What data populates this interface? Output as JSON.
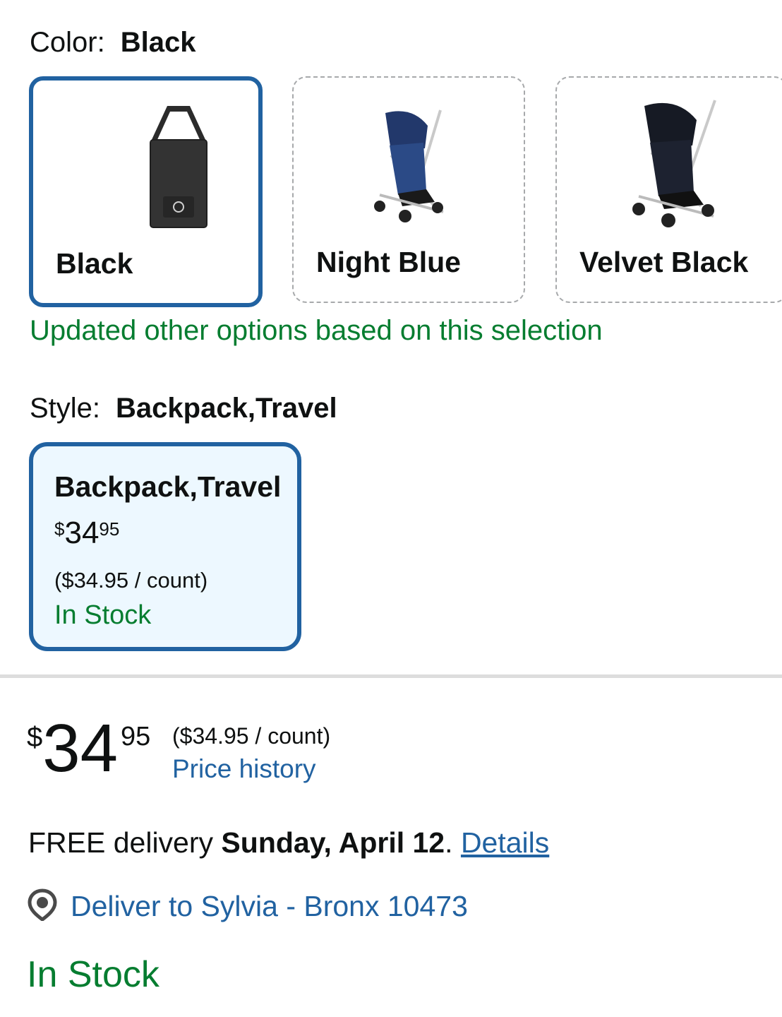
{
  "color": {
    "label": "Color:",
    "value": "Black",
    "options": [
      {
        "name": "Black",
        "thumb": "travel-bag-icon",
        "selected": true
      },
      {
        "name": "Night Blue",
        "thumb": "stroller-icon",
        "selected": false
      },
      {
        "name": "Velvet Black",
        "thumb": "stroller-icon",
        "selected": false
      }
    ],
    "update_note": "Updated other options based on this selection"
  },
  "style": {
    "label": "Style:",
    "value": "Backpack,Travel",
    "card": {
      "title": "Backpack,Travel",
      "price_symbol": "$",
      "price_whole": "34",
      "price_fraction": "95",
      "unit_price": "($34.95 / count)",
      "availability": "In Stock"
    }
  },
  "price": {
    "symbol": "$",
    "whole": "34",
    "fraction": "95",
    "unit_price": "($34.95 / count)",
    "history_link": "Price history"
  },
  "delivery": {
    "prefix": "FREE delivery",
    "date": "Sunday, April 12",
    "suffix": ".",
    "details_link": "Details"
  },
  "deliver_to": {
    "icon": "location-pin-icon",
    "text": "Deliver to Sylvia - Bronx 10473"
  },
  "availability": "In Stock",
  "colors": {
    "accent_blue": "#2162a1",
    "success_green": "#067d30",
    "selected_card_bg": "#edf8ff"
  }
}
